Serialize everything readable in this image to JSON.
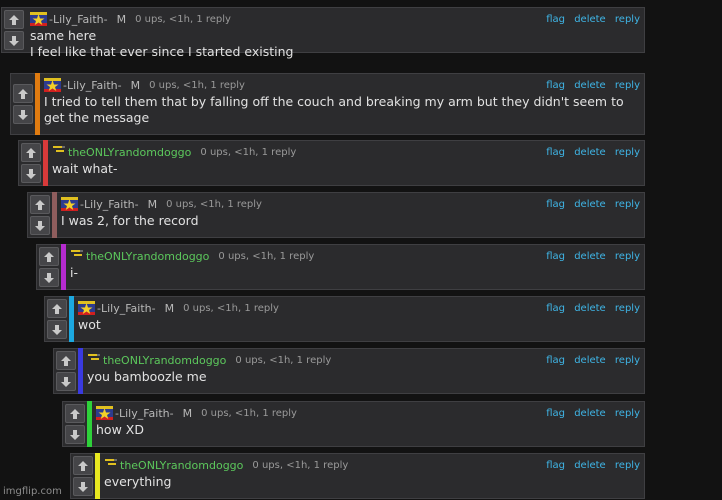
{
  "actions": {
    "flag": "flag",
    "delete": "delete",
    "reply": "reply"
  },
  "watermark": "imgflip.com",
  "comments": [
    {
      "username": "-Lily_Faith-",
      "role": "M",
      "stats": "0 ups, <1h, 1 reply",
      "text": "same here\nI feel like that ever since I started existing",
      "avatar": "star-flag-icon",
      "bar_color": "none"
    },
    {
      "username": "-Lily_Faith-",
      "role": "M",
      "stats": "0 ups, <1h, 1 reply",
      "text": "I tried to tell them that by falling off the couch and breaking my arm but they didn't seem to get the message",
      "avatar": "star-flag-icon",
      "bar_color": "#e07b10"
    },
    {
      "username": "theONLYrandomdoggo",
      "role": "",
      "stats": "0 ups, <1h, 1 reply",
      "text": "wait what-",
      "avatar": "dash-icon",
      "bar_color": "#d83a3a"
    },
    {
      "username": "-Lily_Faith-",
      "role": "M",
      "stats": "0 ups, <1h, 1 reply",
      "text": "I was 2, for the record",
      "avatar": "star-flag-icon",
      "bar_color": "#8f5d5d"
    },
    {
      "username": "theONLYrandomdoggo",
      "role": "",
      "stats": "0 ups, <1h, 1 reply",
      "text": "i-",
      "avatar": "dash-icon",
      "bar_color": "#b62bd0"
    },
    {
      "username": "-Lily_Faith-",
      "role": "M",
      "stats": "0 ups, <1h, 1 reply",
      "text": "wot",
      "avatar": "star-flag-icon",
      "bar_color": "#1ca8e0"
    },
    {
      "username": "theONLYrandomdoggo",
      "role": "",
      "stats": "0 ups, <1h, 1 reply",
      "text": "you bamboozle me",
      "avatar": "dash-icon",
      "bar_color": "#3a3ae0"
    },
    {
      "username": "-Lily_Faith-",
      "role": "M",
      "stats": "0 ups, <1h, 1 reply",
      "text": "how XD",
      "avatar": "star-flag-icon",
      "bar_color": "#2ed13a"
    },
    {
      "username": "theONLYrandomdoggo",
      "role": "",
      "stats": "0 ups, <1h, 1 reply",
      "text": "everything",
      "avatar": "dash-icon",
      "bar_color": "#e8e820"
    }
  ]
}
